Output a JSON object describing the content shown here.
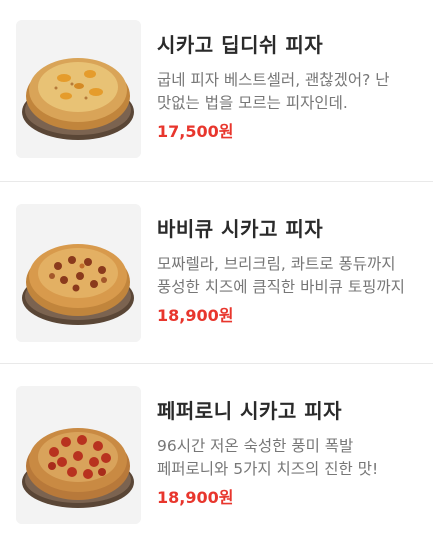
{
  "menu": {
    "items": [
      {
        "name": "시카고 딥디쉬 피자",
        "description": "굽네 피자 베스트셀러, 괜찮겠어? 난 맛없는 법을 모르는 피자인데.",
        "price": "17,500원",
        "image_icon": "pizza-deep-dish-icon",
        "colors": {
          "crust": "#d9a458",
          "cheese": "#e8c275",
          "topping": "#e59c2c"
        }
      },
      {
        "name": "바비큐 시카고 피자",
        "description": "모짜렐라, 브리크림, 콰트로 퐁듀까지 풍성한 치즈에 큼직한 바비큐 토핑까지",
        "price": "18,900원",
        "image_icon": "pizza-bbq-icon",
        "colors": {
          "crust": "#d89a4c",
          "cheese": "#e3b063",
          "topping": "#8a3a1c"
        }
      },
      {
        "name": "페퍼로니 시카고 피자",
        "description": "96시간 저온 숙성한 풍미 폭발 페퍼로니와 5가지 치즈의 진한 맛!",
        "price": "18,900원",
        "image_icon": "pizza-pepperoni-icon",
        "colors": {
          "crust": "#c98a43",
          "cheese": "#d9a35b",
          "topping": "#b8321f"
        }
      }
    ]
  }
}
